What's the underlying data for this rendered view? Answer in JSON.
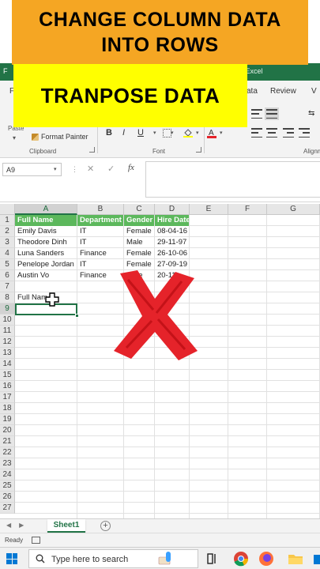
{
  "overlay": {
    "top_banner_line1": "CHANGE COLUMN DATA",
    "top_banner_line2": "INTO ROWS",
    "yellow_banner": "TRANPOSE DATA"
  },
  "window": {
    "title_suffix": "t - Excel",
    "title_f": "F"
  },
  "ribbon": {
    "tabs": {
      "data": "ata",
      "review": "Review",
      "view": "V",
      "file": "F"
    },
    "paste_label": "Paste",
    "format_painter": "Format Painter",
    "groups": {
      "clipboard": "Clipboard",
      "font": "Font",
      "alignment": "Alignm"
    },
    "font_buttons": {
      "bold": "B",
      "italic": "I",
      "underline": "U"
    }
  },
  "formula_bar": {
    "name_box": "A9",
    "fx": "fx",
    "value": ""
  },
  "sheet": {
    "columns": [
      "A",
      "B",
      "C",
      "D",
      "E",
      "F",
      "G"
    ],
    "rows": [
      "1",
      "2",
      "3",
      "4",
      "5",
      "6",
      "7",
      "8",
      "9",
      "10",
      "11",
      "12",
      "13",
      "14",
      "15",
      "16",
      "17",
      "18",
      "19",
      "20",
      "21",
      "22",
      "23",
      "24",
      "25",
      "26",
      "27"
    ],
    "header": [
      "Full Name",
      "Department",
      "Gender",
      "Hire Date"
    ],
    "data": [
      [
        "Emily Davis",
        "IT",
        "Female",
        "08-04-16"
      ],
      [
        "Theodore Dinh",
        "IT",
        "Male",
        "29-11-97"
      ],
      [
        "Luna Sanders",
        "Finance",
        "Female",
        "26-10-06"
      ],
      [
        "Penelope Jordan",
        "IT",
        "Female",
        "27-09-19"
      ],
      [
        "Austin Vo",
        "Finance",
        "Male",
        "20-11-"
      ]
    ],
    "a8": "Full Nam",
    "tab_name": "Sheet1"
  },
  "status": {
    "ready": "Ready"
  },
  "taskbar": {
    "search_placeholder": "Type here to search"
  },
  "colors": {
    "excel_green": "#217346",
    "header_fill": "#5cb85c",
    "banner_orange": "#f5a623",
    "banner_yellow": "#ffff00",
    "x_red": "#e5232a"
  }
}
